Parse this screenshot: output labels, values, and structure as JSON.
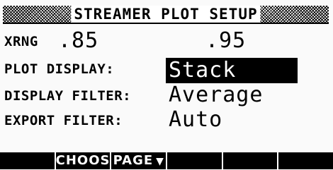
{
  "title": "STREAMER PLOT SETUP",
  "fields": {
    "xrng": {
      "label": "XRNG",
      "min": ".85",
      "max": ".95"
    },
    "plot_display": {
      "label": "PLOT DISPLAY:",
      "value": "Stack"
    },
    "display_filter": {
      "label": "DISPLAY FILTER:",
      "value": "Average"
    },
    "export_filter": {
      "label": "EXPORT FILTER:",
      "value": "Auto"
    }
  },
  "menu": {
    "keys": [
      "",
      "CHOOS",
      "PAGE",
      "",
      "",
      ""
    ],
    "page_icon": "down-triangle-icon"
  }
}
